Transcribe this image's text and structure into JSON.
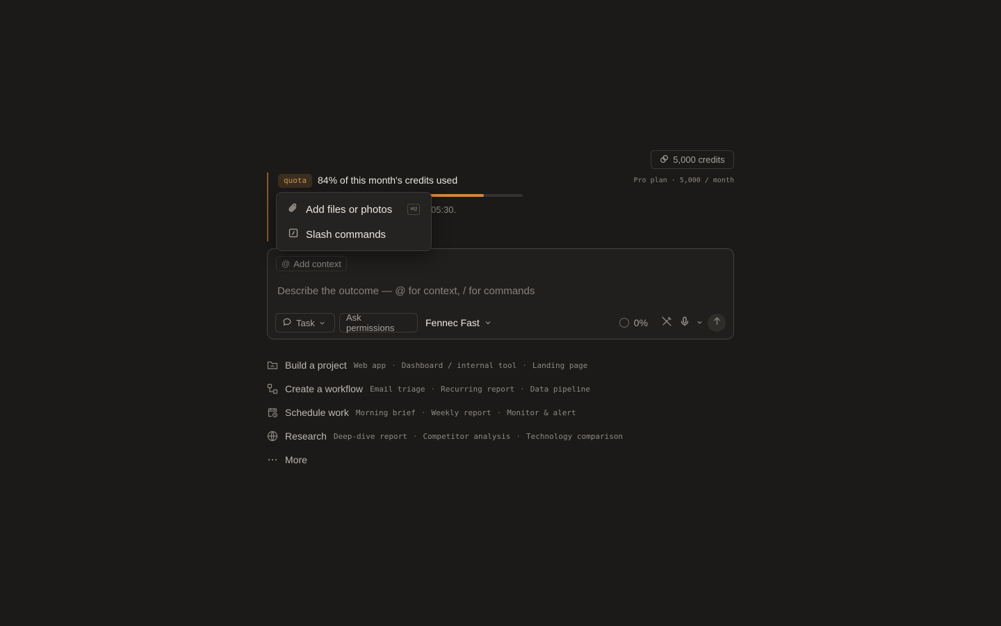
{
  "credits": {
    "label": "5,000 credits",
    "icon": "credits-icon"
  },
  "quota": {
    "badge": "quota",
    "title": "84% of this month's credits used",
    "plan": "Pro plan · 5,000 / month",
    "used_fraction": 0.84,
    "reset_text_visible": "05:30.",
    "accent_color": "#d08a3c"
  },
  "popover": {
    "items": [
      {
        "label": "Add files or photos",
        "icon": "paperclip-icon",
        "shortcut": "⌘U"
      },
      {
        "label": "Slash commands",
        "icon": "slash-square-icon"
      }
    ]
  },
  "composer": {
    "context_chip": "Add context",
    "placeholder": "Describe the outcome — @ for context, / for commands",
    "task_label": "Task",
    "permissions_label": "Ask permissions",
    "model_label": "Fennec Fast",
    "progress": "0%"
  },
  "suggestions": [
    {
      "title": "Build a project",
      "icon": "folder-icon",
      "tags": [
        "Web app",
        "Dashboard / internal tool",
        "Landing page"
      ]
    },
    {
      "title": "Create a workflow",
      "icon": "workflow-icon",
      "tags": [
        "Email triage",
        "Recurring report",
        "Data pipeline"
      ]
    },
    {
      "title": "Schedule work",
      "icon": "calendar-clock-icon",
      "tags": [
        "Morning brief",
        "Weekly report",
        "Monitor & alert"
      ]
    },
    {
      "title": "Research",
      "icon": "globe-icon",
      "tags": [
        "Deep-dive report",
        "Competitor analysis",
        "Technology comparison"
      ]
    },
    {
      "title": "More",
      "icon": "more-icon",
      "tags": []
    }
  ]
}
